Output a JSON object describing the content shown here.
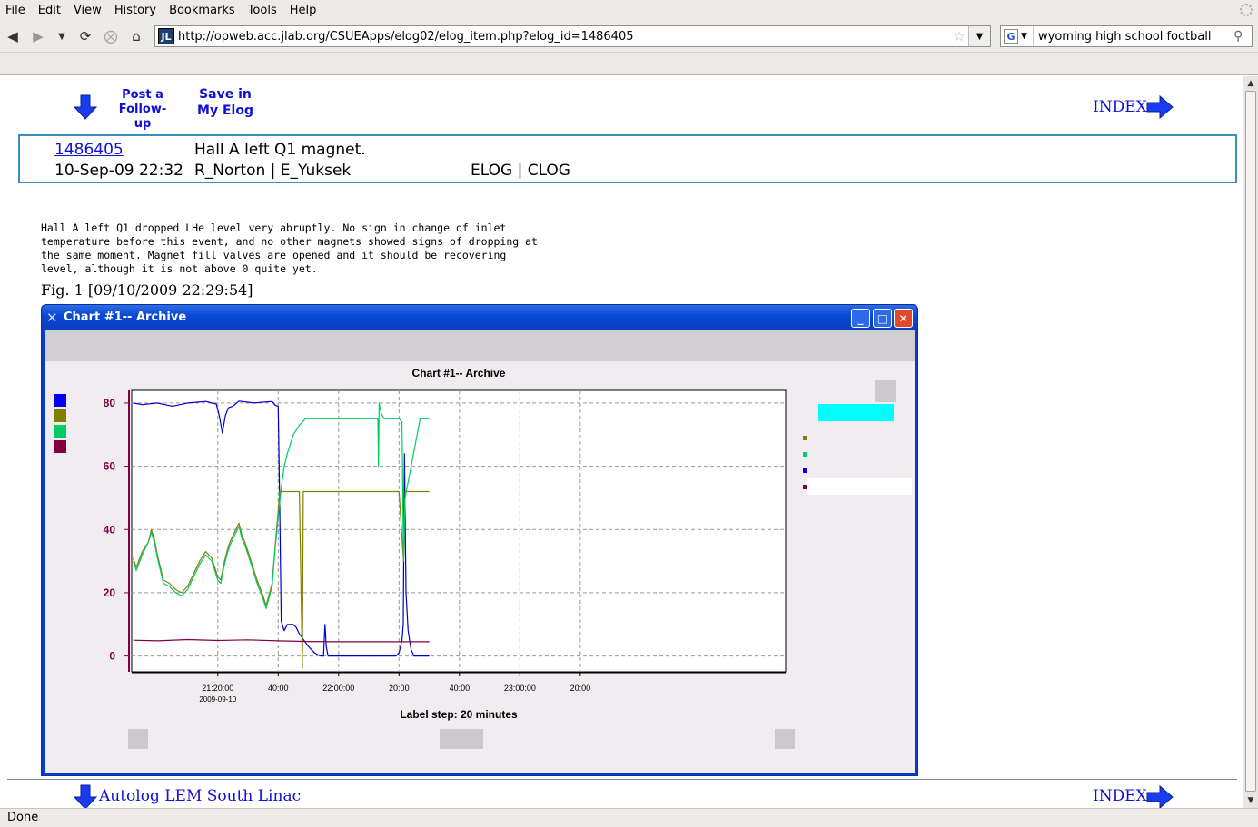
{
  "menu": [
    "File",
    "Edit",
    "View",
    "History",
    "Bookmarks",
    "Tools",
    "Help"
  ],
  "address": {
    "site_icon": "JL",
    "url": "http://opweb.acc.jlab.org/CSUEApps/elog02/elog_item.php?elog_id=1486405"
  },
  "search": {
    "engine_glyph": "G",
    "query": "wyoming high school football"
  },
  "top_links": {
    "post_line1": "Post a",
    "post_line2": "Follow-up",
    "save_line1": "Save in",
    "save_line2": "My Elog",
    "index": "INDEX"
  },
  "entry": {
    "id": "1486405",
    "title": "Hall A left Q1 magnet.",
    "datetime": "10-Sep-09 22:32",
    "authors": "R_Norton | E_Yuksek",
    "logbooks": "ELOG | CLOG",
    "body": "Hall A left Q1 dropped LHe level very abruptly. No sign in change of inlet\ntemperature before this event, and no other magnets showed signs of dropping at\nthe same moment. Magnet fill valves are opened and it should be recovering\nlevel, although it is not above 0 quite yet."
  },
  "figure": {
    "caption": "Fig. 1 [09/10/2009 22:29:54]"
  },
  "chart_window": {
    "title": "Chart #1-- Archive"
  },
  "chart_data": {
    "type": "line",
    "title": "Chart #1-- Archive",
    "xlabel": "Label step: 20 minutes",
    "ylabel": "",
    "ylim": [
      -5,
      84
    ],
    "xlim_minutes": [
      -28.5,
      188
    ],
    "y_ticks": [
      0,
      20,
      40,
      60,
      80
    ],
    "x_ticks": [
      {
        "m": 0,
        "label": "21:20:00",
        "sub": "2009-09-10"
      },
      {
        "m": 20,
        "label": "40:00"
      },
      {
        "m": 40,
        "label": "22:00:00"
      },
      {
        "m": 60,
        "label": "20:00"
      },
      {
        "m": 80,
        "label": "40:00"
      },
      {
        "m": 100,
        "label": "23:00:00"
      },
      {
        "m": 120,
        "label": "20:00"
      }
    ],
    "grid": true,
    "legend": "right",
    "series": [
      {
        "color": "#0000cc",
        "points": [
          [
            -28,
            80
          ],
          [
            -25,
            79.5
          ],
          [
            -20,
            80
          ],
          [
            -15,
            79
          ],
          [
            -10,
            80
          ],
          [
            -4,
            80.5
          ],
          [
            -0.5,
            79.7
          ],
          [
            0.5,
            76
          ],
          [
            1.5,
            70.5
          ],
          [
            2.5,
            76
          ],
          [
            3.5,
            78.5
          ],
          [
            5,
            79
          ],
          [
            7,
            80.6
          ],
          [
            12,
            80
          ],
          [
            18,
            80.5
          ],
          [
            19,
            79.3
          ],
          [
            20,
            79
          ],
          [
            20.3,
            60
          ],
          [
            20.6,
            40
          ],
          [
            21,
            11
          ],
          [
            22,
            8
          ],
          [
            23,
            10
          ],
          [
            25,
            10
          ],
          [
            26,
            9
          ],
          [
            27,
            7
          ],
          [
            30,
            3
          ],
          [
            32,
            1
          ],
          [
            34,
            0
          ],
          [
            35,
            0
          ],
          [
            35.5,
            10
          ],
          [
            35.9,
            3
          ],
          [
            36.5,
            0
          ],
          [
            50,
            0
          ],
          [
            59,
            0
          ],
          [
            60,
            1
          ],
          [
            61,
            5
          ],
          [
            61.4,
            10
          ],
          [
            61.8,
            64
          ],
          [
            62.3,
            20
          ],
          [
            63,
            8
          ],
          [
            64,
            2
          ],
          [
            65,
            0
          ],
          [
            70,
            0
          ]
        ]
      },
      {
        "color": "#808000",
        "points": [
          [
            -28,
            31
          ],
          [
            -27,
            28
          ],
          [
            -25,
            33
          ],
          [
            -23,
            36
          ],
          [
            -22,
            40
          ],
          [
            -21,
            37
          ],
          [
            -20,
            32
          ],
          [
            -19,
            28
          ],
          [
            -18,
            24
          ],
          [
            -16,
            23
          ],
          [
            -14,
            21
          ],
          [
            -12,
            20
          ],
          [
            -10,
            22
          ],
          [
            -8,
            26
          ],
          [
            -6,
            30
          ],
          [
            -4,
            33
          ],
          [
            -2,
            31
          ],
          [
            0,
            25
          ],
          [
            1,
            24
          ],
          [
            2,
            29
          ],
          [
            3,
            33
          ],
          [
            4,
            36
          ],
          [
            5,
            38
          ],
          [
            6,
            40
          ],
          [
            7,
            42
          ],
          [
            8,
            38
          ],
          [
            9,
            36
          ],
          [
            11,
            30
          ],
          [
            13,
            24
          ],
          [
            15,
            19
          ],
          [
            16,
            16
          ],
          [
            18,
            23
          ],
          [
            19,
            35
          ],
          [
            20,
            46
          ],
          [
            20.5,
            52
          ],
          [
            27,
            52
          ],
          [
            28,
            -4
          ],
          [
            28.3,
            52
          ],
          [
            60,
            52
          ],
          [
            61.5,
            30
          ],
          [
            62,
            52
          ],
          [
            70,
            52
          ]
        ]
      },
      {
        "color": "#00cc66",
        "points": [
          [
            -28,
            30
          ],
          [
            -27,
            27
          ],
          [
            -25,
            32
          ],
          [
            -23,
            36
          ],
          [
            -22,
            39
          ],
          [
            -21,
            36
          ],
          [
            -20,
            31
          ],
          [
            -19,
            27
          ],
          [
            -18,
            23
          ],
          [
            -16,
            22
          ],
          [
            -14,
            20
          ],
          [
            -12,
            19
          ],
          [
            -10,
            21
          ],
          [
            -8,
            25
          ],
          [
            -6,
            29
          ],
          [
            -4,
            32
          ],
          [
            -2,
            30
          ],
          [
            0,
            24
          ],
          [
            1,
            23
          ],
          [
            2,
            28
          ],
          [
            3,
            32
          ],
          [
            4,
            35
          ],
          [
            5,
            37
          ],
          [
            6,
            39
          ],
          [
            7,
            41
          ],
          [
            8,
            37
          ],
          [
            9,
            35
          ],
          [
            11,
            29
          ],
          [
            13,
            23
          ],
          [
            15,
            18
          ],
          [
            16,
            15
          ],
          [
            18,
            22
          ],
          [
            19,
            34
          ],
          [
            20,
            44
          ],
          [
            21,
            53
          ],
          [
            22,
            60
          ],
          [
            23,
            64
          ],
          [
            25,
            70
          ],
          [
            27,
            73
          ],
          [
            29,
            75
          ],
          [
            50,
            75
          ],
          [
            53,
            75
          ],
          [
            53.2,
            60
          ],
          [
            53.4,
            80
          ],
          [
            54,
            77
          ],
          [
            55,
            75
          ],
          [
            60,
            75
          ],
          [
            61,
            74
          ],
          [
            61.5,
            30
          ],
          [
            62,
            50
          ],
          [
            64,
            60
          ],
          [
            66,
            70
          ],
          [
            67,
            75
          ],
          [
            70,
            75
          ]
        ]
      },
      {
        "color": "#800040",
        "points": [
          [
            -28,
            5
          ],
          [
            -20,
            4.8
          ],
          [
            -10,
            5.2
          ],
          [
            0,
            4.9
          ],
          [
            10,
            5.1
          ],
          [
            20,
            4.8
          ],
          [
            30,
            4.6
          ],
          [
            40,
            4.5
          ],
          [
            50,
            4.5
          ],
          [
            60,
            4.5
          ],
          [
            70,
            4.5
          ]
        ]
      }
    ]
  },
  "footer": {
    "prev_link": "Autolog LEM South Linac",
    "index": "INDEX"
  },
  "status": "Done",
  "colors": {
    "link": "#1010d8",
    "frame": "#3c8fbd",
    "titlebar": "#0a4ad2"
  }
}
